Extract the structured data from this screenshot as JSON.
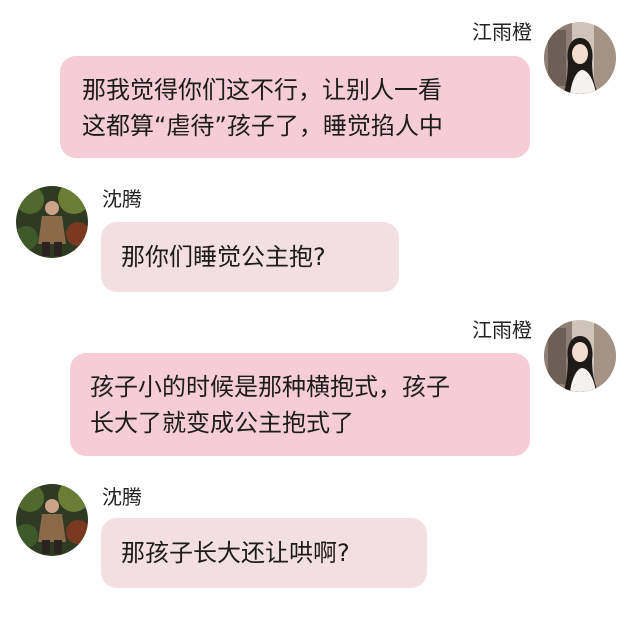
{
  "chat": {
    "messages": [
      {
        "sender": "江雨橙",
        "side": "right",
        "avatar_icon": "avatar-female-photo",
        "lines": [
          "那我觉得你们这不行，让别人一看",
          "这都算“虐待”孩子了，睡觉掐人中"
        ]
      },
      {
        "sender": "沈腾",
        "side": "left",
        "avatar_icon": "avatar-male-photo",
        "lines": [
          "那你们睡觉公主抱?"
        ]
      },
      {
        "sender": "江雨橙",
        "side": "right",
        "avatar_icon": "avatar-female-photo",
        "lines": [
          "孩子小的时候是那种横抱式，孩子",
          "长大了就变成公主抱式了"
        ]
      },
      {
        "sender": "沈腾",
        "side": "left",
        "avatar_icon": "avatar-male-photo",
        "lines": [
          "那孩子长大还让哄啊?"
        ]
      }
    ]
  },
  "colors": {
    "bubble_right": "#f6ccd6",
    "bubble_left": "#f2dfe2",
    "text": "#1c1c1c",
    "name": "#222222",
    "background": "#ffffff"
  }
}
